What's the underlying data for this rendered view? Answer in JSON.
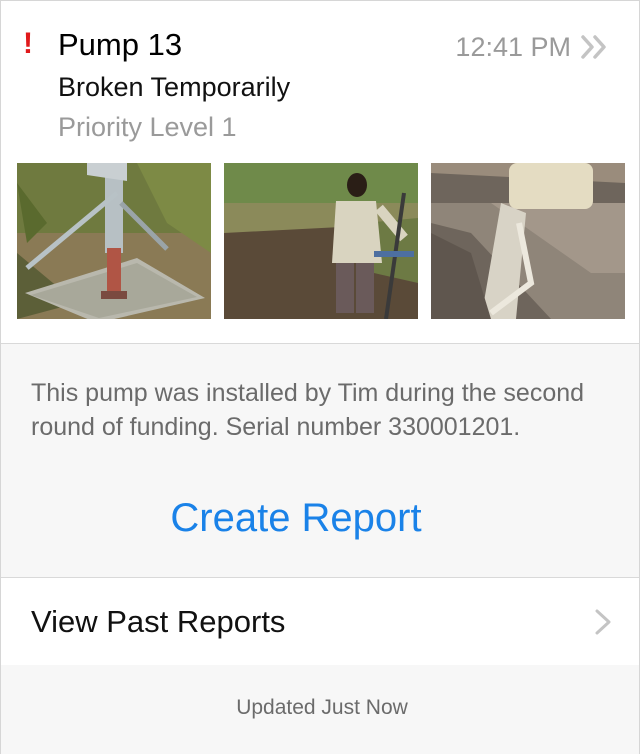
{
  "header": {
    "alert_icon": "exclamation-icon",
    "alert_glyph": "!",
    "alert_color": "#e0191b",
    "title": "Pump 13",
    "status": "Broken Temporarily",
    "priority": "Priority Level 1",
    "time": "12:41 PM",
    "disclosure_icon": "double-chevron-right-icon"
  },
  "photos": [
    {
      "name": "pump-photo"
    },
    {
      "name": "person-photo"
    },
    {
      "name": "trough-photo"
    }
  ],
  "details": {
    "description": "This pump was installed by Tim during the second round of funding. Serial number 330001201.",
    "create_report_label": "Create Report",
    "accent_color": "#1a82e8"
  },
  "past_reports": {
    "label": "View Past Reports",
    "icon": "chevron-right-icon"
  },
  "footer": {
    "updated_text": "Updated Just Now"
  }
}
